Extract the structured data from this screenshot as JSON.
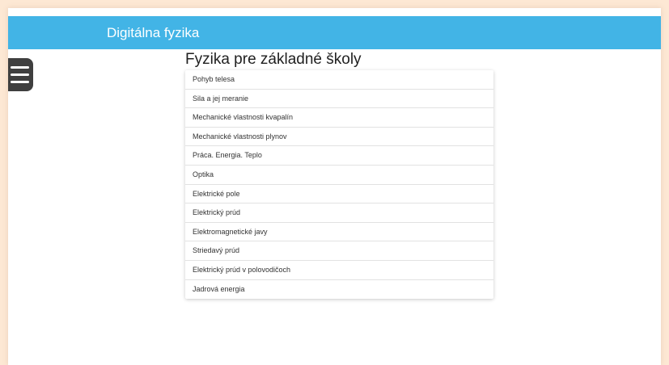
{
  "header": {
    "title": "Digitálna fyzika",
    "color": "#42b4e6"
  },
  "menu": {
    "icon": "hamburger-menu-icon"
  },
  "main": {
    "title": "Fyzika pre základné školy",
    "topics": [
      {
        "label": "Pohyb telesa"
      },
      {
        "label": "Sila a jej meranie"
      },
      {
        "label": "Mechanické vlastnosti kvapalín"
      },
      {
        "label": "Mechanické vlastnosti plynov"
      },
      {
        "label": "Práca. Energia. Teplo"
      },
      {
        "label": "Optika"
      },
      {
        "label": "Elektrické pole"
      },
      {
        "label": "Elektrický prúd"
      },
      {
        "label": "Elektromagnetické javy"
      },
      {
        "label": "Striedavý prúd"
      },
      {
        "label": "Elektrický prúd v polovodičoch"
      },
      {
        "label": "Jadrová energia"
      }
    ]
  }
}
